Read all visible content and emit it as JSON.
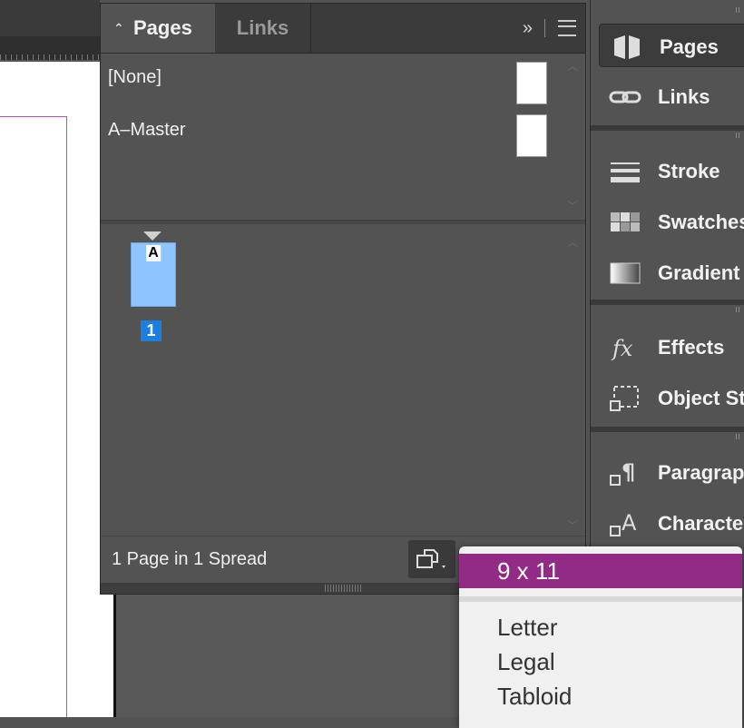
{
  "panel": {
    "tabs": [
      {
        "label": "Pages",
        "active": true
      },
      {
        "label": "Links",
        "active": false
      }
    ],
    "expand_glyph": "»",
    "menu_icon": "hamburger-icon"
  },
  "masters": [
    {
      "label": "[None]"
    },
    {
      "label": "A–Master"
    }
  ],
  "pages": [
    {
      "number": "1",
      "master_prefix": "A"
    }
  ],
  "status": {
    "text": "1 Page in 1 Spread"
  },
  "dock": {
    "items": [
      {
        "label": "Pages",
        "icon": "pages-icon",
        "active": true
      },
      {
        "label": "Links",
        "icon": "links-icon"
      },
      {
        "label": "Stroke",
        "icon": "stroke-icon"
      },
      {
        "label": "Swatches",
        "icon": "swatches-icon"
      },
      {
        "label": "Gradient",
        "icon": "gradient-icon"
      },
      {
        "label": "Effects",
        "icon": "fx-icon"
      },
      {
        "label": "Object St",
        "icon": "object-styles-icon"
      },
      {
        "label": "Paragrap",
        "icon": "paragraph-styles-icon"
      },
      {
        "label": "Characte",
        "icon": "character-styles-icon"
      }
    ]
  },
  "page_size_menu": {
    "selected": "9 x 11",
    "options": [
      "Letter",
      "Legal",
      "Tabloid"
    ]
  },
  "colors": {
    "selected_accent": "#922b86",
    "page_number_bg": "#1a7fe0",
    "page_thumb": "#8fc5ff",
    "margin_guide": "#c04bc0"
  }
}
